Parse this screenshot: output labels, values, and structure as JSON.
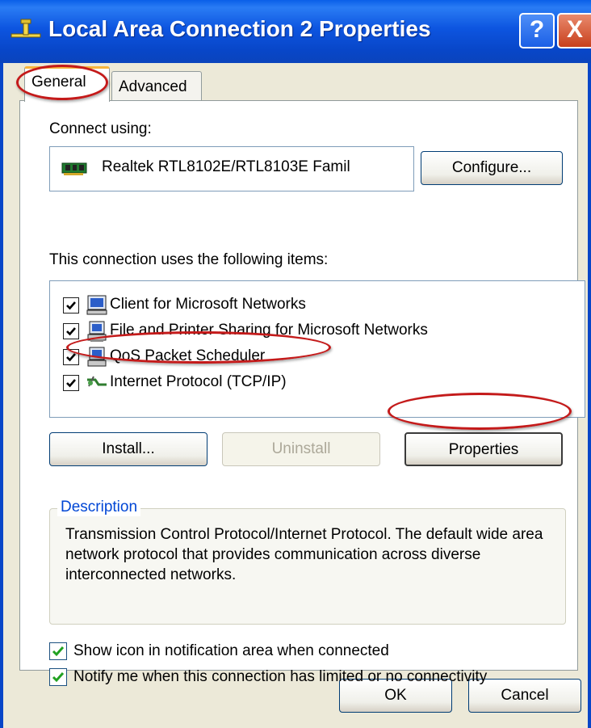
{
  "window": {
    "title": "Local Area Connection 2 Properties",
    "help_glyph": "?",
    "close_glyph": "X"
  },
  "tabs": [
    {
      "label": "General",
      "selected": true
    },
    {
      "label": "Advanced",
      "selected": false
    }
  ],
  "general": {
    "connect_using_label": "Connect using:",
    "adapter_name": "Realtek RTL8102E/RTL8103E Famil",
    "configure_button": "Configure...",
    "items_label": "This connection uses the following items:",
    "items": [
      {
        "label": "Client for Microsoft Networks",
        "checked": true,
        "icon": "network-client-icon"
      },
      {
        "label": "File and Printer Sharing for Microsoft Networks",
        "checked": true,
        "icon": "file-printer-sharing-icon"
      },
      {
        "label": "QoS Packet Scheduler",
        "checked": true,
        "icon": "qos-scheduler-icon"
      },
      {
        "label": "Internet Protocol (TCP/IP)",
        "checked": true,
        "icon": "protocol-icon"
      }
    ],
    "install_button": "Install...",
    "uninstall_button": "Uninstall",
    "properties_button": "Properties",
    "description_legend": "Description",
    "description_text": "Transmission Control Protocol/Internet Protocol. The default wide area network protocol that provides communication across diverse interconnected networks.",
    "show_icon_label": "Show icon in notification area when connected",
    "show_icon_checked": true,
    "notify_label": "Notify me when this connection has limited or no connectivity",
    "notify_checked": true
  },
  "footer": {
    "ok_button": "OK",
    "cancel_button": "Cancel"
  },
  "colors": {
    "titlebar": "#0846c8",
    "annotation": "#c41a1a",
    "window_face": "#ece9d8"
  }
}
